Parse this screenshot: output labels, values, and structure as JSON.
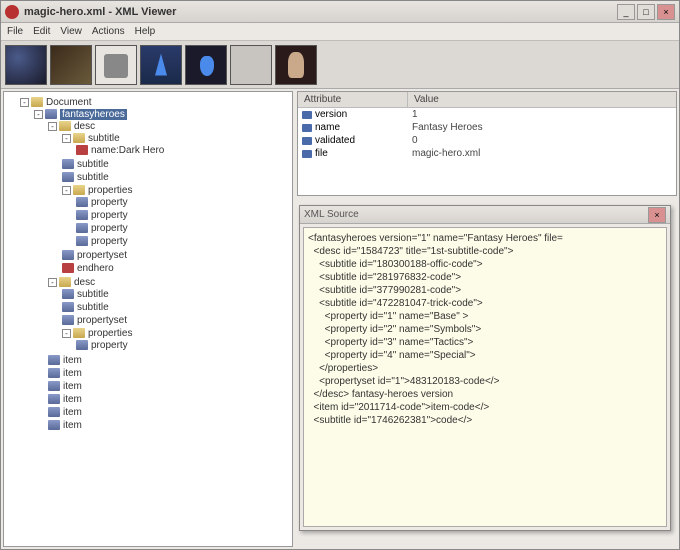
{
  "title": "magic-hero.xml - XML Viewer",
  "menu": {
    "file": "File",
    "edit": "Edit",
    "view": "View",
    "actions": "Actions",
    "help": "Help"
  },
  "tree": {
    "root": "Document",
    "selected": "fantasyheroes",
    "n_desc": "desc",
    "n_sub": "subtitle",
    "n_namefield": "name:Dark Hero",
    "n_sub1": "subtitle",
    "n_sub2": "subtitle",
    "n_props": "properties",
    "n_prop": "property",
    "n_propset": "propertyset",
    "n_endhero": "endhero",
    "n_item": "item"
  },
  "attrs": {
    "hdr_attr": "Attribute",
    "hdr_val": "Value",
    "r1a": "version",
    "r1v": "1",
    "r2a": "name",
    "r2v": "Fantasy Heroes",
    "r3a": "validated",
    "r3v": "0",
    "r4a": "file",
    "r4v": "magic-hero.xml"
  },
  "src": {
    "title": "XML Source",
    "l0": "<fantasyheroes version=\"1\" name=\"Fantasy Heroes\" file=",
    "l1": "  <desc id=\"1584723\" title=\"1st-subtitle-code\">",
    "l2": "    <subtitle id=\"180300188-offic-code\">",
    "l3": "    <subtitle id=\"281976832-code\">",
    "l4": "    <subtitle id=\"377990281-code\">",
    "l5": "    <subtitle id=\"472281047-trick-code\">",
    "l6": "      <property id=\"1\" name=\"Base\" >",
    "l7": "      <property id=\"2\" name=\"Symbols\">",
    "l8": "      <property id=\"3\" name=\"Tactics\">",
    "l9": "      <property id=\"4\" name=\"Special\">",
    "l10": "    </properties>",
    "l11": "    <propertyset id=\"1\">483120183-code</>",
    "l12": "  </desc> fantasy-heroes version",
    "l13": "  <item id=\"2011714-code\">item-code</>",
    "l14": "  <subtitle id=\"1746262381\">code</>"
  }
}
